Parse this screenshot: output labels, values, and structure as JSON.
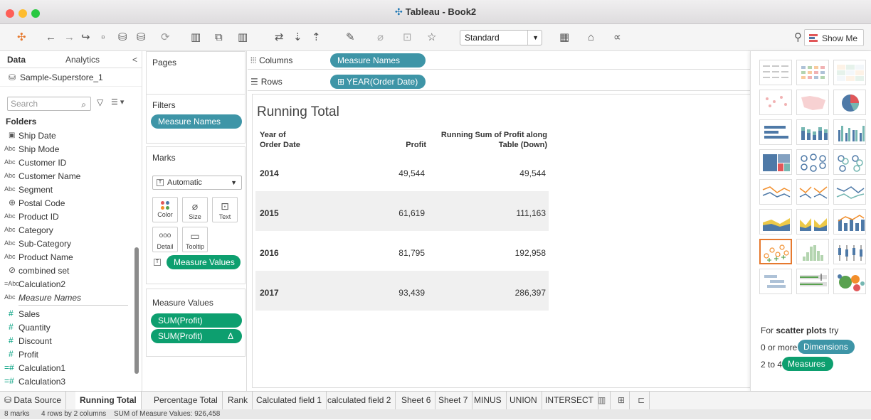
{
  "window": {
    "title": "Tableau - Book2"
  },
  "toolbar": {
    "mark_size": "Standard",
    "show_me_label": "Show Me"
  },
  "data_pane": {
    "tabs": [
      "Data",
      "Analytics"
    ],
    "collapse": "<",
    "source": "Sample-Superstore_1",
    "search_placeholder": "Search",
    "folders_label": "Folders",
    "fields": [
      {
        "type": "date",
        "name": "Ship Date"
      },
      {
        "type": "Abc",
        "name": "Ship Mode"
      },
      {
        "type": "Abc",
        "name": "Customer ID"
      },
      {
        "type": "Abc",
        "name": "Customer Name"
      },
      {
        "type": "Abc",
        "name": "Segment"
      },
      {
        "type": "geo",
        "name": "Postal Code"
      },
      {
        "type": "Abc",
        "name": "Product ID"
      },
      {
        "type": "Abc",
        "name": "Category"
      },
      {
        "type": "Abc",
        "name": "Sub-Category"
      },
      {
        "type": "Abc",
        "name": "Product Name"
      },
      {
        "type": "set",
        "name": "combined set"
      },
      {
        "type": "=Abc",
        "name": "Calculation2"
      },
      {
        "type": "Abc",
        "name": "Measure Names"
      }
    ],
    "measures": [
      {
        "type": "#",
        "name": "Sales"
      },
      {
        "type": "#",
        "name": "Quantity"
      },
      {
        "type": "#",
        "name": "Discount"
      },
      {
        "type": "#",
        "name": "Profit"
      },
      {
        "type": "=#",
        "name": "Calculation1"
      },
      {
        "type": "=#",
        "name": "Calculation3"
      },
      {
        "type": "#",
        "name": "Sample-Superstore_1"
      }
    ]
  },
  "cards": {
    "pages_title": "Pages",
    "filters_title": "Filters",
    "filters_pill": "Measure Names",
    "marks_title": "Marks",
    "marks_type": "Automatic",
    "marks_buttons": [
      "Color",
      "Size",
      "Text",
      "Detail",
      "Tooltip"
    ],
    "marks_pill": "Measure Values",
    "measure_values_title": "Measure Values",
    "measure_values_pills": [
      "SUM(Profit)",
      "SUM(Profit)"
    ],
    "delta": "Δ"
  },
  "shelves": {
    "columns_label": "Columns",
    "columns_pill": "Measure Names",
    "rows_label": "Rows",
    "rows_pill": "⊞ YEAR(Order Date)"
  },
  "view": {
    "title": "Running Total",
    "headers": {
      "year_line1": "Year of",
      "year_line2": "Order Date",
      "profit": "Profit",
      "running_line1": "Running Sum of Profit along",
      "running_line2": "Table (Down)"
    }
  },
  "chart_data": {
    "type": "table",
    "title": "Running Total",
    "columns": [
      "Year of Order Date",
      "Profit",
      "Running Sum of Profit along Table (Down)"
    ],
    "rows": [
      {
        "year": "2014",
        "profit": "49,544",
        "running": "49,544"
      },
      {
        "year": "2015",
        "profit": "61,619",
        "running": "111,163"
      },
      {
        "year": "2016",
        "profit": "81,795",
        "running": "192,958"
      },
      {
        "year": "2017",
        "profit": "93,439",
        "running": "286,397"
      }
    ]
  },
  "show_me": {
    "hint_prefix": "For",
    "hint_bold": "scatter plots",
    "hint_suffix": "try",
    "dim_prefix": "0 or more",
    "dim_pill": "Dimensions",
    "meas_prefix": "2 to 4",
    "meas_pill": "Measures"
  },
  "sheet_tabs": {
    "data_source": "Data Source",
    "sheets": [
      "Running Total",
      "Percentage Total",
      "Rank",
      "Calculated field 1",
      "calculated field 2",
      "Sheet 6",
      "Sheet 7",
      "MINUS",
      "UNION",
      "INTERSECT"
    ],
    "active": "Running Total"
  },
  "status": {
    "marks": "8 marks",
    "rows_cols": "4 rows by 2 columns",
    "sum": "SUM of Measure Values: 926,458"
  },
  "colors": {
    "pill_blue": "#3e95a7",
    "pill_green": "#0d9f6f",
    "alt_row": "#f0f0f0",
    "selected_thumb": "#e6792e"
  }
}
